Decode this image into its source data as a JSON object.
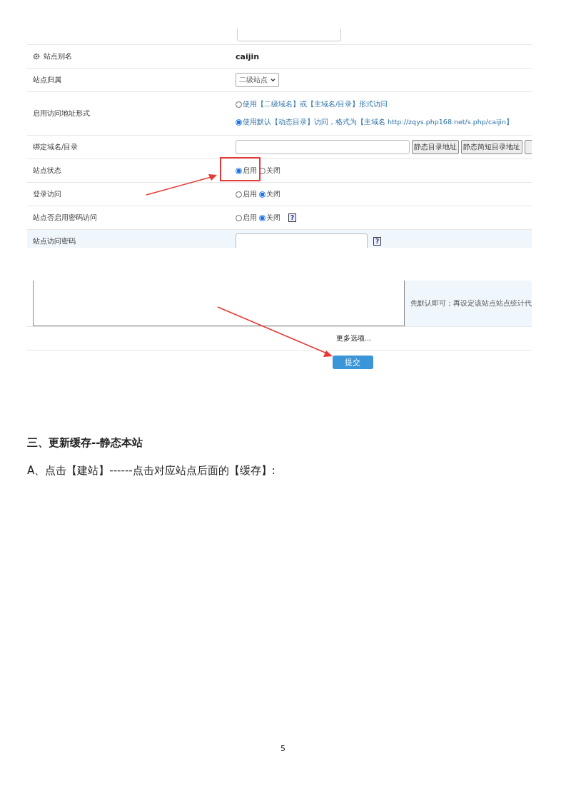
{
  "screenshot_1": {
    "rows": [
      {
        "kind": "heading",
        "label": "站点别名",
        "value": "caijin"
      },
      {
        "kind": "select",
        "label": "站点归属",
        "value": "二级站点"
      },
      {
        "kind": "choice_lines",
        "label": "启用访问地址形式",
        "options": [
          {
            "label": "使用【二级域名】或【主域名/目录】形式访问",
            "selected": false
          },
          {
            "label": "使用默认【动态目录】访问，格式为【主域名 http://zqys.php168.net/s.php/caijin】",
            "selected": true
          }
        ]
      },
      {
        "kind": "domain",
        "label": "绑定域名/目录",
        "buttons": [
          "静态目录地址",
          "静态简短目录地址"
        ]
      },
      {
        "kind": "choice",
        "label": "站点状态",
        "options": [
          {
            "label": "启用",
            "selected": true
          },
          {
            "label": "关闭",
            "selected": false
          }
        ]
      },
      {
        "kind": "choice",
        "label": "登录访问",
        "options": [
          {
            "label": "启用",
            "selected": false
          },
          {
            "label": "关闭",
            "selected": true
          }
        ]
      },
      {
        "kind": "choice",
        "label": "站点否启用密码访问",
        "help": "?",
        "options": [
          {
            "label": "启用",
            "selected": false
          },
          {
            "label": "关闭",
            "selected": true
          }
        ]
      },
      {
        "kind": "password",
        "label": "站点访问密码",
        "help": "?"
      }
    ]
  },
  "screenshot_2": {
    "hint": "先默认即可；再设定该站点站点统计代",
    "more_options": "更多选项...",
    "submit": "提交"
  },
  "heading": "三、更新缓存--静态本站",
  "paragraph": "A、点击【建站】------点击对应站点后面的【缓存】:",
  "page_number": "5"
}
